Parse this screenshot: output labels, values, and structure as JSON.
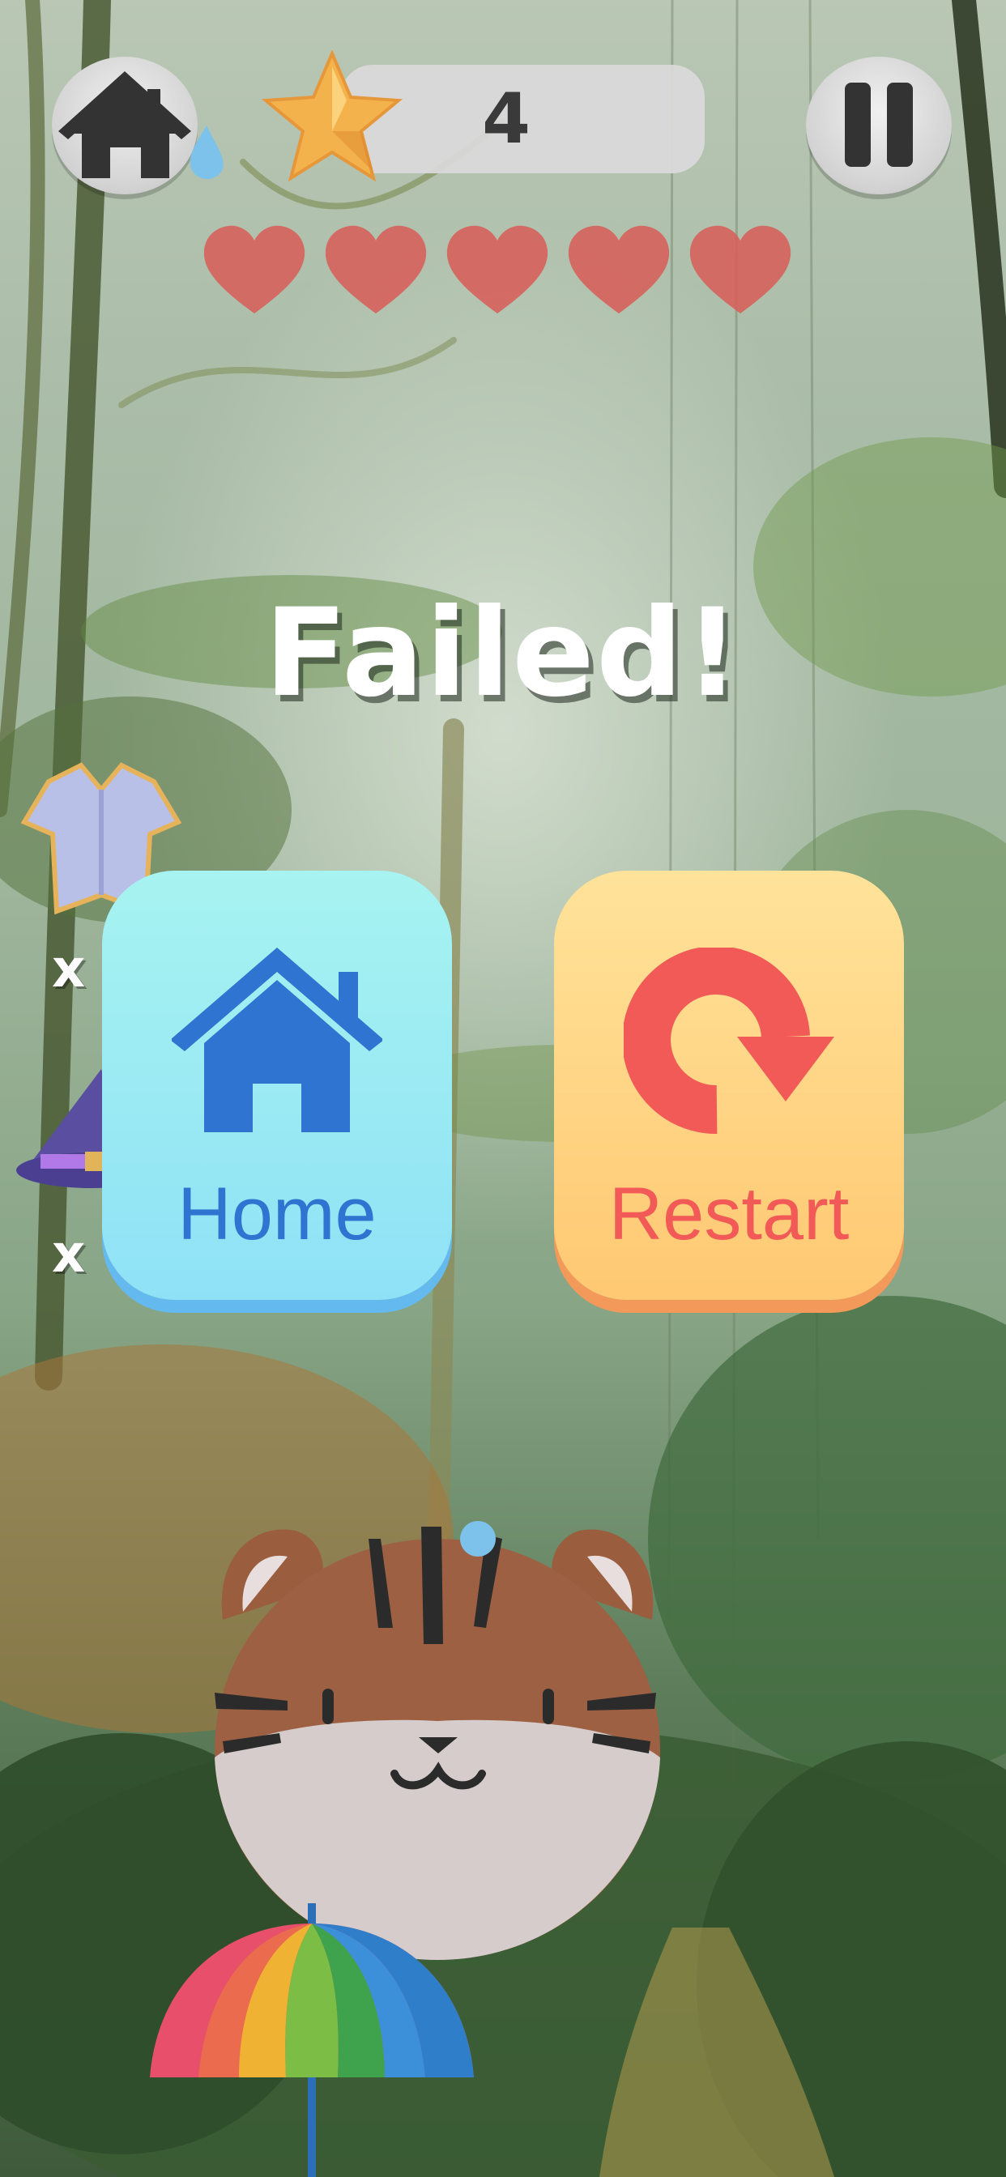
{
  "hud": {
    "score": "4",
    "lives": [
      {
        "name": "heart-1"
      },
      {
        "name": "heart-2"
      },
      {
        "name": "heart-3"
      },
      {
        "name": "heart-4"
      },
      {
        "name": "heart-5"
      }
    ],
    "home_icon": "home-icon",
    "pause_icon": "pause-icon",
    "star_icon": "star-icon"
  },
  "overlay": {
    "title": "Failed!",
    "home_label": "Home",
    "restart_label": "Restart"
  },
  "powerups": [
    {
      "icon": "armor-icon",
      "label": "x"
    },
    {
      "icon": "wizard-hat-icon",
      "label": "x"
    }
  ],
  "colors": {
    "home_card": "#a7f3f1",
    "home_text": "#2f74d0",
    "restart_card": "#ffd27e",
    "restart_text": "#f25a57",
    "heart": "#d85c57"
  }
}
